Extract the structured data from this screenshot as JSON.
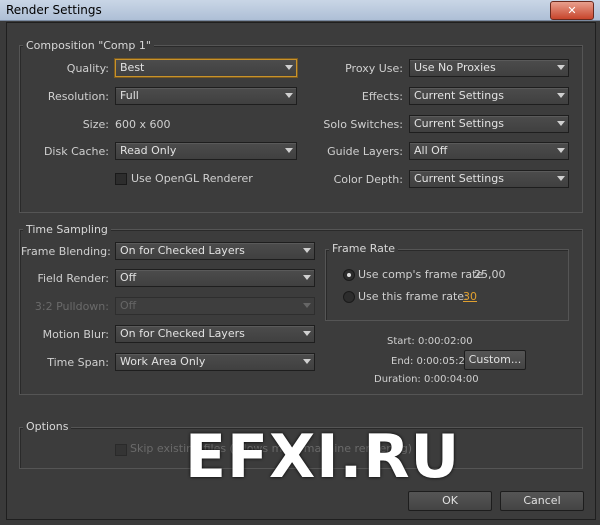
{
  "window": {
    "title": "Render Settings",
    "close_glyph": "✕"
  },
  "composition": {
    "title": "Composition \"Comp 1\"",
    "quality": {
      "label": "Quality:",
      "value": "Best"
    },
    "resolution": {
      "label": "Resolution:",
      "value": "Full"
    },
    "size": {
      "label": "Size:",
      "value": "600 x 600"
    },
    "disk_cache": {
      "label": "Disk Cache:",
      "value": "Read Only"
    },
    "opengl": {
      "label": "Use OpenGL Renderer",
      "checked": false
    },
    "proxy_use": {
      "label": "Proxy Use:",
      "value": "Use No Proxies"
    },
    "effects": {
      "label": "Effects:",
      "value": "Current Settings"
    },
    "solo_switches": {
      "label": "Solo Switches:",
      "value": "Current Settings"
    },
    "guide_layers": {
      "label": "Guide Layers:",
      "value": "All Off"
    },
    "color_depth": {
      "label": "Color Depth:",
      "value": "Current Settings"
    }
  },
  "time_sampling": {
    "title": "Time Sampling",
    "frame_blending": {
      "label": "Frame Blending:",
      "value": "On for Checked Layers"
    },
    "field_render": {
      "label": "Field Render:",
      "value": "Off"
    },
    "pulldown": {
      "label": "3:2 Pulldown:",
      "value": "Off"
    },
    "motion_blur": {
      "label": "Motion Blur:",
      "value": "On for Checked Layers"
    },
    "time_span": {
      "label": "Time Span:",
      "value": "Work Area Only"
    },
    "frame_rate": {
      "title": "Frame Rate",
      "use_comp_label": "Use comp's frame rate",
      "comp_rate": "25,00",
      "use_this_label": "Use this frame rate:",
      "this_rate": "30",
      "selected": "comp"
    },
    "start": "Start: 0:00:02:00",
    "end": "End: 0:00:05:24",
    "duration": "Duration: 0:00:04:00",
    "custom_button": "Custom..."
  },
  "options": {
    "title": "Options",
    "skip_label": "Skip existing files (allows multi-machine rendering)"
  },
  "buttons": {
    "ok": "OK",
    "cancel": "Cancel"
  },
  "watermark": "EFXI.RU",
  "colors": {
    "accent": "#c8922a",
    "titlebar": "#b8c8dc",
    "close": "#c8452c"
  }
}
